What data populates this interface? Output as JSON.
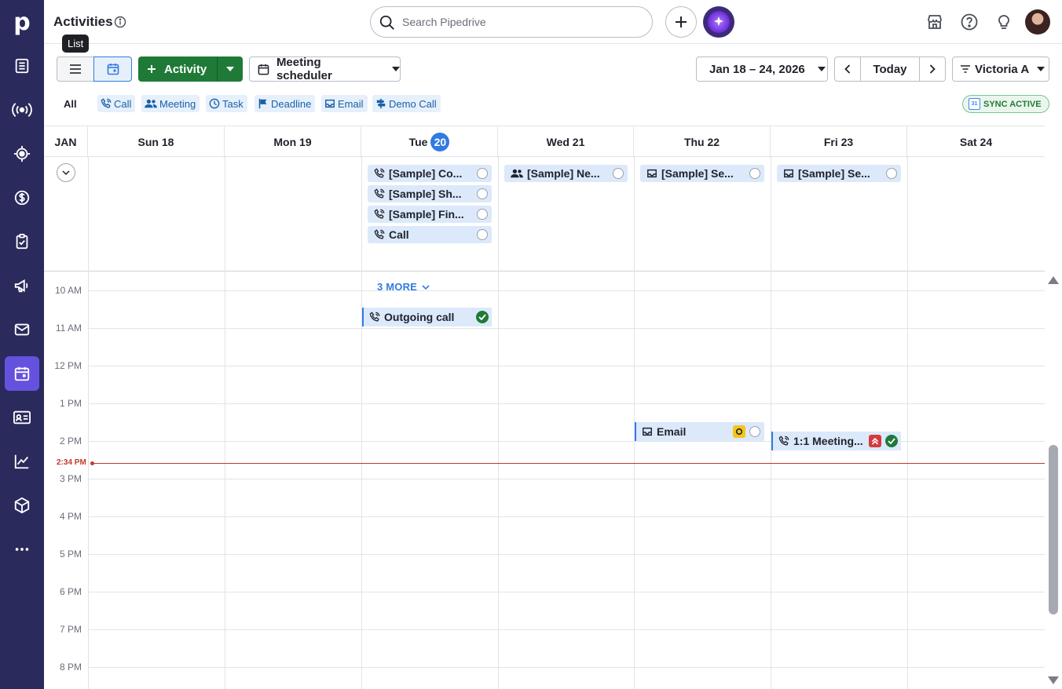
{
  "app": {
    "logo": "p"
  },
  "sidebar": {
    "items": [
      {
        "name": "leads-icon"
      },
      {
        "name": "campaigns-radar-icon"
      },
      {
        "name": "target-icon"
      },
      {
        "name": "deals-dollar-icon"
      },
      {
        "name": "tasks-clipboard-icon"
      },
      {
        "name": "megaphone-icon"
      },
      {
        "name": "mail-icon"
      },
      {
        "name": "calendar-icon",
        "active": true
      },
      {
        "name": "contacts-card-icon"
      },
      {
        "name": "insights-chart-icon"
      },
      {
        "name": "products-box-icon"
      },
      {
        "name": "more-dots-icon"
      }
    ]
  },
  "header": {
    "title": "Activities",
    "search_placeholder": "Search Pipedrive",
    "tooltip": "List"
  },
  "toolbar": {
    "activity_label": "Activity",
    "scheduler_label": "Meeting scheduler",
    "date_range": "Jan 18 – 24, 2026",
    "today_label": "Today",
    "user_filter": "Victoria A"
  },
  "filters": {
    "all": "All",
    "types": [
      "Call",
      "Meeting",
      "Task",
      "Deadline",
      "Email",
      "Demo Call"
    ],
    "sync_status": "SYNC ACTIVE",
    "gcal_label": "31"
  },
  "calendar": {
    "month": "JAN",
    "days": [
      {
        "label": "Sun 18"
      },
      {
        "label": "Mon 19"
      },
      {
        "label": "Tue",
        "num": "20",
        "today": true
      },
      {
        "label": "Wed 21"
      },
      {
        "label": "Thu 22"
      },
      {
        "label": "Fri 23"
      },
      {
        "label": "Sat 24"
      }
    ],
    "all_day": [
      {
        "day": 2,
        "row": 0,
        "icon": "phone",
        "title": "[Sample] Co..."
      },
      {
        "day": 2,
        "row": 1,
        "icon": "phone",
        "title": "[Sample] Sh..."
      },
      {
        "day": 2,
        "row": 2,
        "icon": "phone",
        "title": "[Sample] Fin..."
      },
      {
        "day": 2,
        "row": 3,
        "icon": "phone",
        "title": "Call"
      },
      {
        "day": 3,
        "row": 0,
        "icon": "meeting",
        "title": "[Sample] Ne..."
      },
      {
        "day": 4,
        "row": 0,
        "icon": "email",
        "title": "[Sample] Se..."
      },
      {
        "day": 5,
        "row": 0,
        "icon": "email",
        "title": "[Sample] Se..."
      }
    ],
    "more_label": "3 MORE",
    "hours": [
      "10 AM",
      "11 AM",
      "12 PM",
      "1 PM",
      "2 PM",
      "3 PM",
      "4 PM",
      "5 PM",
      "6 PM",
      "7 PM",
      "8 PM"
    ],
    "now_label": "2:34 PM",
    "timed": [
      {
        "title": "Outgoing call",
        "icon": "phone",
        "status": "done"
      },
      {
        "title": "Email",
        "icon": "email",
        "status": "open",
        "priority": "yellow"
      },
      {
        "title": "1:1 Meeting...",
        "icon": "phone",
        "status": "done",
        "priority": "red"
      }
    ]
  }
}
